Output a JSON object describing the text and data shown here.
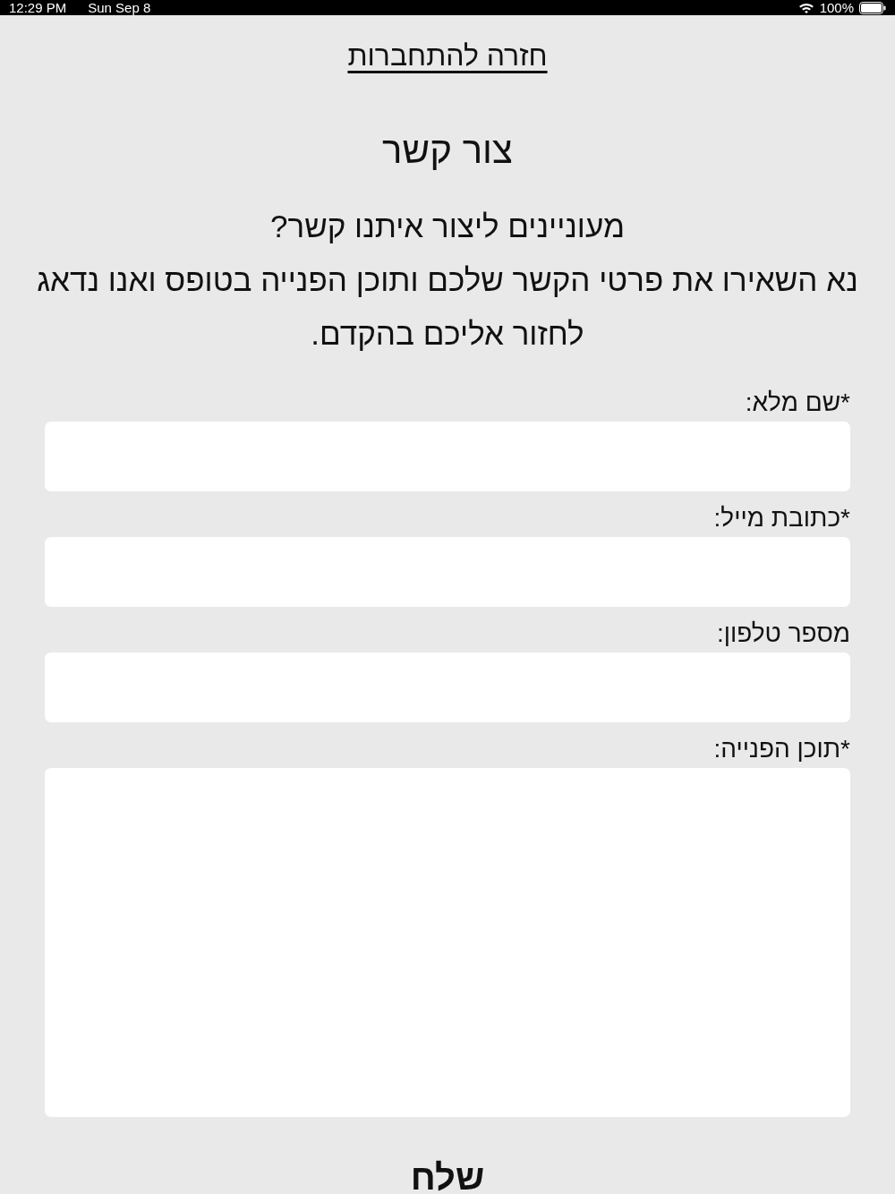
{
  "status_bar": {
    "time": "12:29 PM",
    "date": "Sun Sep 8",
    "battery": "100%"
  },
  "back_link": "חזרה להתחברות",
  "title": "צור קשר",
  "intro": [
    "מעוניינים ליצור איתנו קשר?",
    "נא השאירו את פרטי הקשר שלכם ותוכן הפנייה בטופס ואנו נדאג לחזור אליכם בהקדם."
  ],
  "fields": [
    {
      "label": "*שם מלא:",
      "kind": "input"
    },
    {
      "label": "*כתובת מייל:",
      "kind": "input"
    },
    {
      "label": "מספר טלפון:",
      "kind": "input"
    },
    {
      "label": "*תוכן הפנייה:",
      "kind": "textarea"
    }
  ],
  "submit": "שלח"
}
